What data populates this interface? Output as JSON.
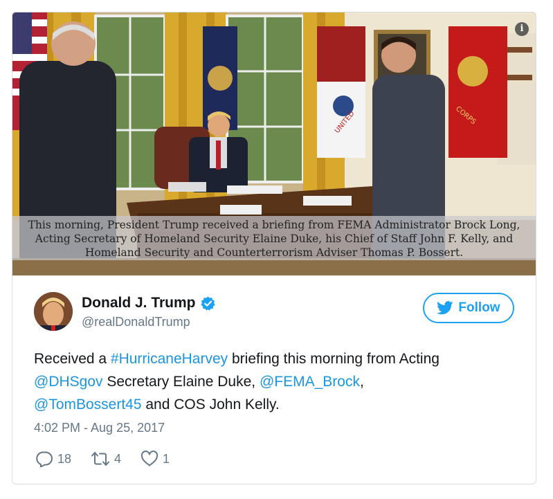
{
  "media": {
    "caption": "This morning, President Trump received a briefing from FEMA Administrator Brock Long,\nActing Secretary of Homeland Security Elaine Duke, his Chief of Staff John F. Kelly, and\nHomeland Security and Counterterrorism Adviser Thomas P. Bossert.",
    "info_icon": "i",
    "flag_texts": [
      "UNITED",
      "CORPS"
    ]
  },
  "author": {
    "display_name": "Donald J. Trump",
    "handle": "@realDonaldTrump",
    "verified_icon": "verified-badge-icon"
  },
  "follow": {
    "label": "Follow",
    "icon": "twitter-bird-icon"
  },
  "tweet": {
    "segments": [
      {
        "text": "Received a ",
        "link": false
      },
      {
        "text": "#HurricaneHarvey",
        "link": true
      },
      {
        "text": " briefing this morning from Acting ",
        "link": false
      },
      {
        "text": "@DHSgov",
        "link": true
      },
      {
        "text": " Secretary Elaine Duke, ",
        "link": false
      },
      {
        "text": "@FEMA_Brock",
        "link": true
      },
      {
        "text": ", ",
        "link": false
      },
      {
        "text": "@TomBossert45",
        "link": true
      },
      {
        "text": " and COS John Kelly.",
        "link": false
      }
    ],
    "timestamp": "4:02 PM - Aug 25, 2017"
  },
  "actions": {
    "replies": "18",
    "retweets": "4",
    "likes": "1"
  },
  "colors": {
    "accent": "#1da1f2",
    "link": "#1b95e0",
    "muted": "#657786",
    "text": "#14171a"
  }
}
